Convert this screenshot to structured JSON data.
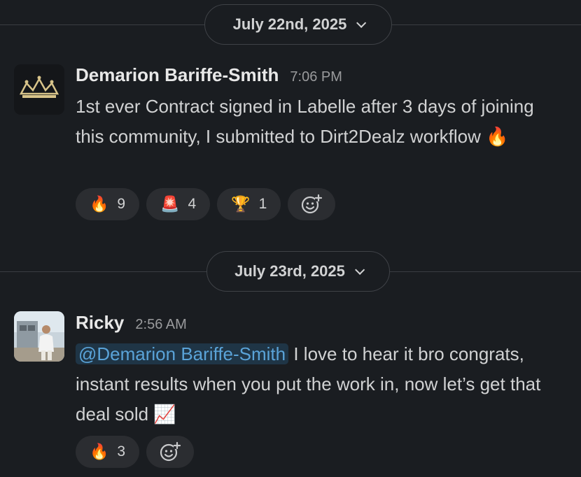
{
  "colors": {
    "background": "#1a1d21",
    "mention": "#5aa3d8",
    "fire": "#ff7a1a"
  },
  "day1": {
    "date_label": "July 22nd, 2025",
    "message": {
      "author": "Demarion Bariffe-Smith",
      "time": "7:06 PM",
      "avatar_icon": "crown-icon",
      "text": "1st ever Contract signed in Labelle after 3 days of joining this community, I submitted to Dirt2Dealz workflow",
      "trailing_emoji": "🔥",
      "reactions": [
        {
          "emoji": "🔥",
          "icon": "fire-icon",
          "count": "9"
        },
        {
          "emoji": "🚨",
          "icon": "siren-icon",
          "count": "4"
        },
        {
          "emoji": "🏆",
          "icon": "trophy-icon",
          "count": "1"
        }
      ]
    }
  },
  "day2": {
    "date_label": "July 23rd, 2025",
    "message": {
      "author": "Ricky",
      "time": "2:56 AM",
      "avatar_icon": "person-photo-icon",
      "mention": "@Demarion Bariffe-Smith",
      "text": " I love to hear it bro congrats, instant results when you put the work in, now let’s get that deal sold ",
      "trailing_emoji": "📈",
      "reactions": [
        {
          "emoji": "🔥",
          "icon": "fire-icon",
          "count": "3"
        }
      ]
    }
  }
}
